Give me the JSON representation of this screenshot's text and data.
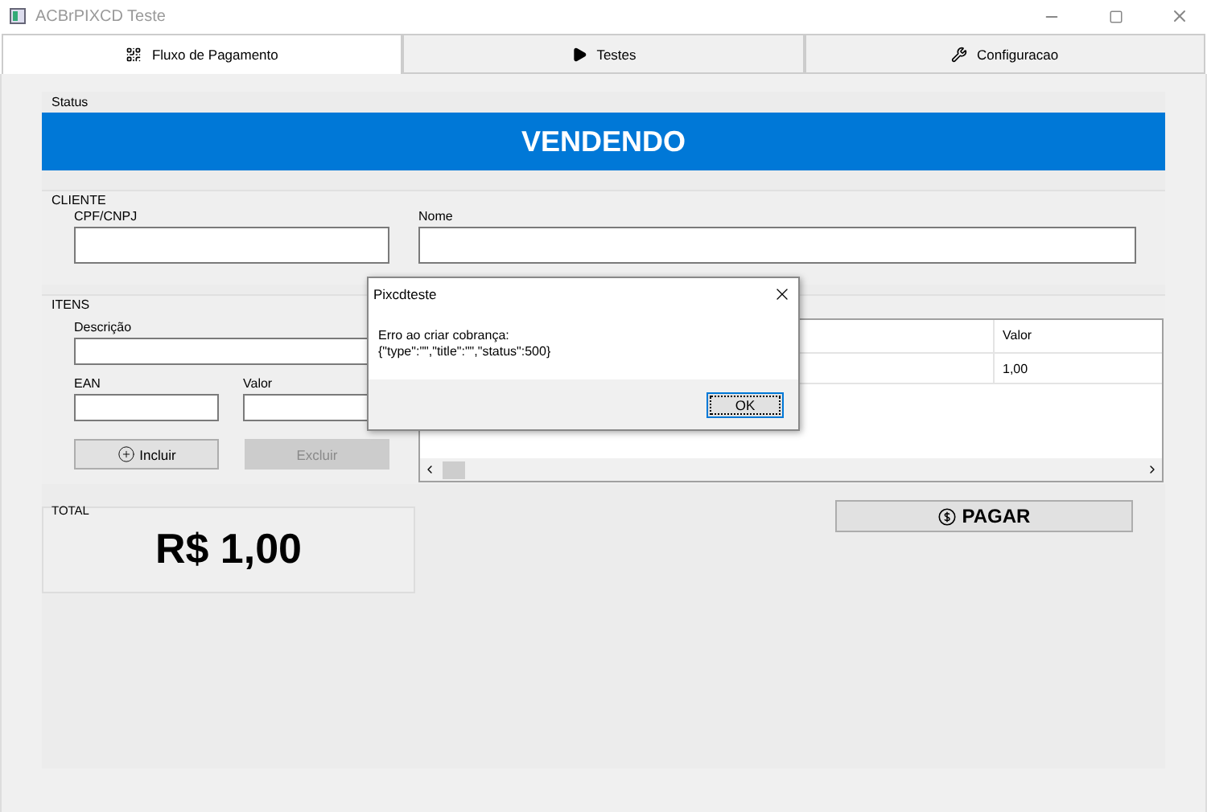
{
  "window": {
    "title": "ACBrPIXCD Teste"
  },
  "tabs": [
    {
      "label": "Fluxo de Pagamento",
      "selected": true
    },
    {
      "label": "Testes",
      "selected": false
    },
    {
      "label": "Configuracao",
      "selected": false
    }
  ],
  "status": {
    "label": "Status",
    "value": "VENDENDO"
  },
  "cliente": {
    "label": "CLIENTE",
    "cpf_label": "CPF/CNPJ",
    "nome_label": "Nome"
  },
  "itens": {
    "label": "ITENS",
    "descricao_label": "Descrição",
    "ean_label": "EAN",
    "valor_label": "Valor",
    "buttons": [
      {
        "label": "Incluir",
        "disabled": false
      },
      {
        "label": "Excluir",
        "disabled": true
      }
    ],
    "grid": {
      "columns": [
        "Valor"
      ],
      "rows": [
        [
          "1,00"
        ]
      ]
    }
  },
  "total": {
    "label": "TOTAL",
    "value": "R$ 1,00"
  },
  "pay_button": "PAGAR",
  "dialog": {
    "title": "Pixcdteste",
    "lines": [
      "Erro ao criar cobrança:",
      "{\"type\":\"\",\"title\":\"\",\"status\":500}"
    ],
    "ok": "OK"
  }
}
